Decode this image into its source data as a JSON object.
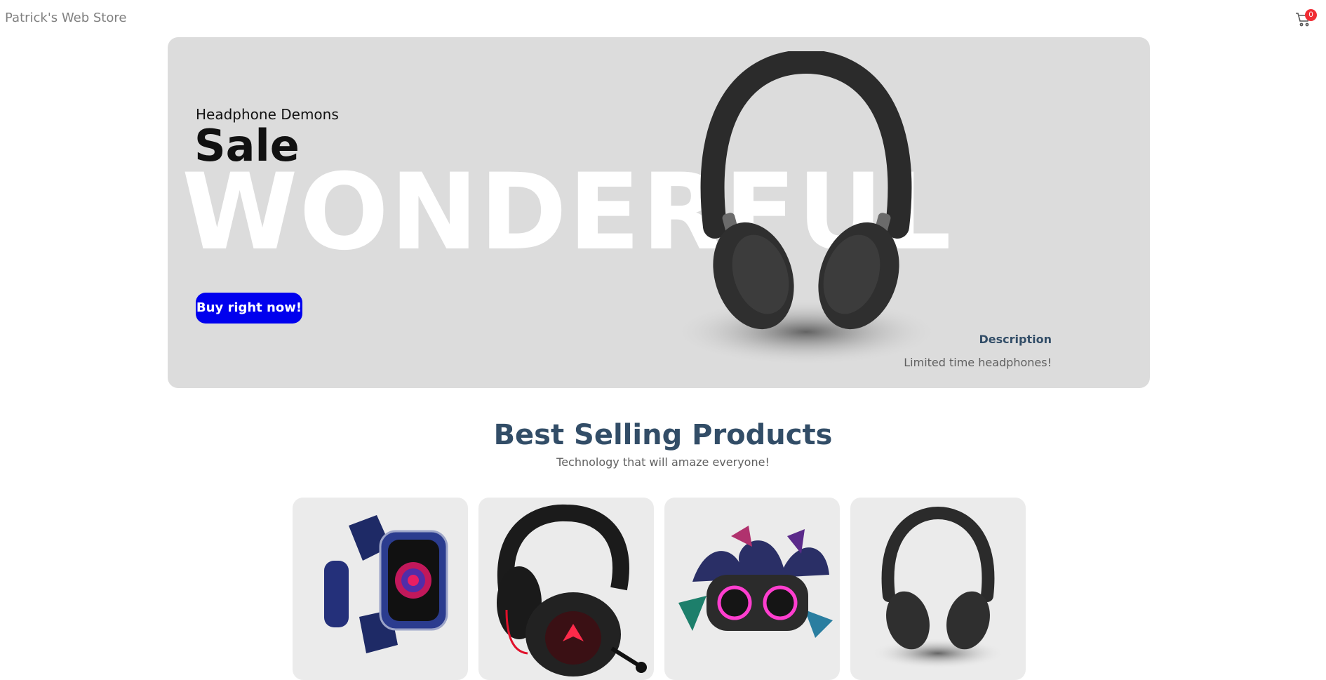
{
  "navbar": {
    "logo_text": "Patrick's Web Store",
    "cart_count": "0",
    "cart_icon": "shopping-cart-icon"
  },
  "hero": {
    "small_text": "Headphone Demons",
    "mid_text": "Sale",
    "large_text": "WONDERFUL",
    "button_label": "Buy right now!",
    "description_title": "Description",
    "description_text": "Limited time headphones!"
  },
  "products_section": {
    "title": "Best Selling Products",
    "subtitle": "Technology that will amaze everyone!"
  },
  "products": [
    {
      "image": "smartwatch"
    },
    {
      "image": "gaming-headset"
    },
    {
      "image": "bluetooth-speaker"
    },
    {
      "image": "headphones"
    }
  ],
  "colors": {
    "accent_button": "#0000ee",
    "heading": "#324d67",
    "badge": "#f02d34",
    "banner_bg": "#dcdcdc"
  }
}
